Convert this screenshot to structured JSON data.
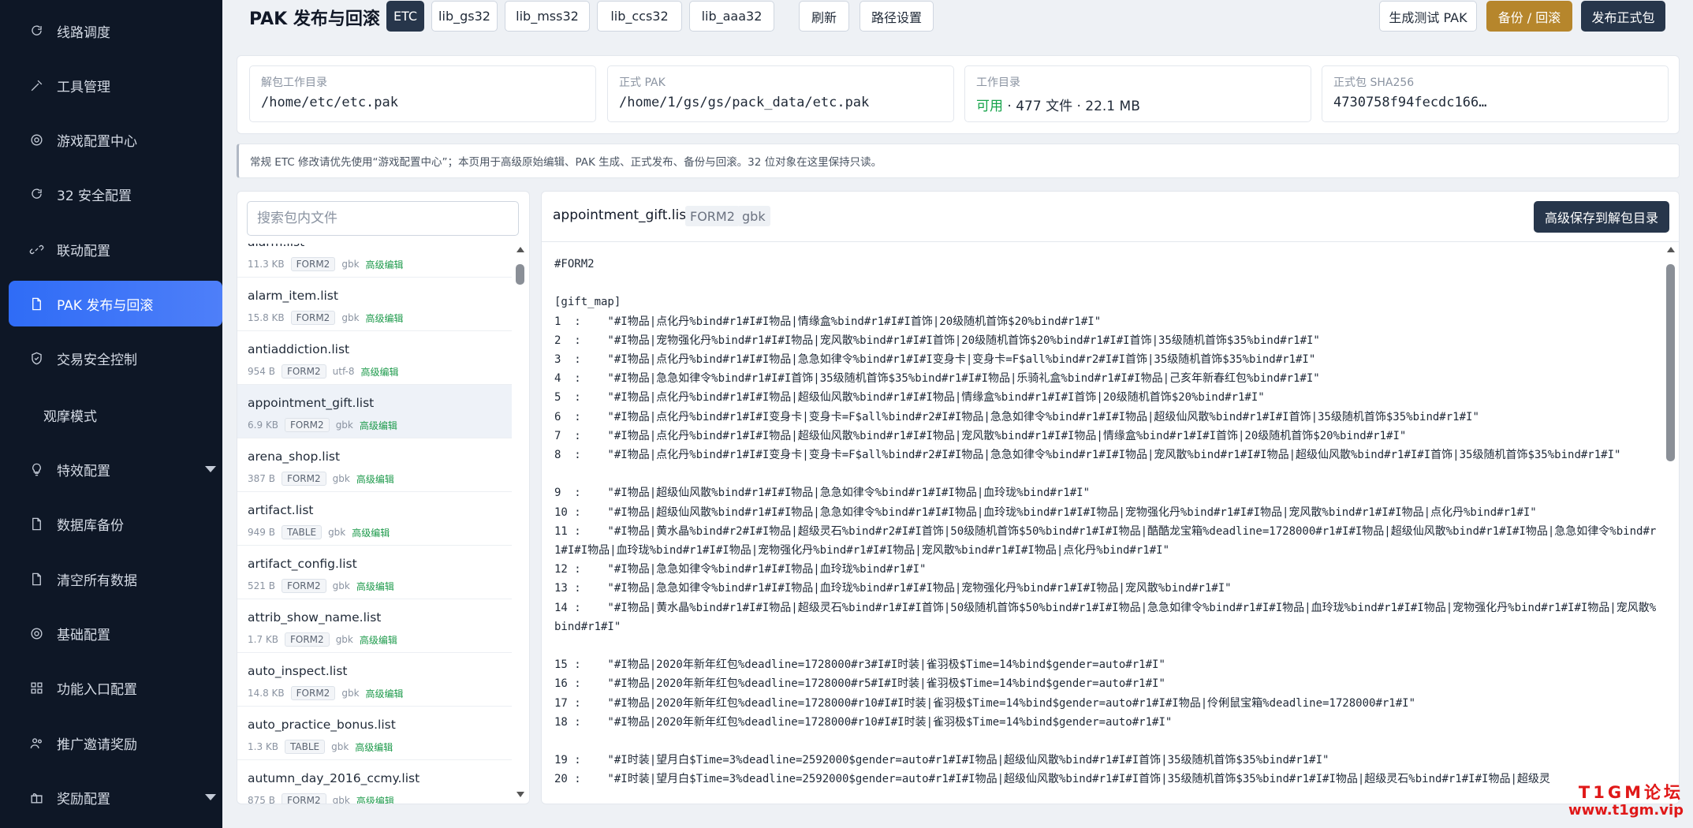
{
  "sidebar": {
    "items": [
      {
        "label": "线路调度",
        "icon": "refresh-icon"
      },
      {
        "label": "工具管理",
        "icon": "tools-icon"
      },
      {
        "label": "游戏配置中心",
        "icon": "gear-icon"
      },
      {
        "label": "32 安全配置",
        "icon": "refresh-icon"
      },
      {
        "label": "联动配置",
        "icon": "link-icon"
      },
      {
        "label": "PAK 发布与回滚",
        "icon": "file-icon"
      },
      {
        "label": "交易安全控制",
        "icon": "shield-icon"
      },
      {
        "label": "观摩模式",
        "icon": ""
      },
      {
        "label": "特效配置",
        "icon": "bulb-icon"
      },
      {
        "label": "数据库备份",
        "icon": "file-icon"
      },
      {
        "label": "清空所有数据",
        "icon": "file-icon"
      },
      {
        "label": "基础配置",
        "icon": "gear-icon"
      },
      {
        "label": "功能入口配置",
        "icon": "grid-icon"
      },
      {
        "label": "推广邀请奖励",
        "icon": "users-icon"
      },
      {
        "label": "奖励配置",
        "icon": "gift-icon"
      }
    ],
    "active_index": 5
  },
  "header": {
    "title": "PAK 发布与回滚",
    "tabs": [
      "ETC",
      "lib_gs32",
      "lib_mss32",
      "lib_ccs32",
      "lib_aaa32"
    ],
    "active_tab": "ETC",
    "refresh": "刷新",
    "path_settings": "路径设置",
    "build_test": "生成测试 PAK",
    "backup_rollback": "备份 / 回滚",
    "publish": "发布正式包"
  },
  "info": {
    "unpack_dir_label": "解包工作目录",
    "unpack_dir": "/home/etc/etc.pak",
    "formal_pak_label": "正式 PAK",
    "formal_pak": "/home/1/gs/gs/pack_data/etc.pak",
    "workdir_label": "工作目录",
    "workdir_status": "可用",
    "workdir_stats": " · 477 文件 · 22.1 MB",
    "sha_label": "正式包 SHA256",
    "sha": "4730758f94fecdc166…"
  },
  "notice": "常规 ETC 修改请优先使用“游戏配置中心”；本页用于高级原始编辑、PAK 生成、正式发布、备份与回滚。32 位对象在这里保持只读。",
  "files": {
    "search_placeholder": "搜索包内文件",
    "edit_label": "高级编辑",
    "items": [
      {
        "name": "alarm.list",
        "size": "11.3 KB",
        "format": "FORM2",
        "enc": "gbk"
      },
      {
        "name": "alarm_item.list",
        "size": "15.8 KB",
        "format": "FORM2",
        "enc": "gbk"
      },
      {
        "name": "antiaddiction.list",
        "size": "954 B",
        "format": "FORM2",
        "enc": "utf-8"
      },
      {
        "name": "appointment_gift.list",
        "size": "6.9 KB",
        "format": "FORM2",
        "enc": "gbk"
      },
      {
        "name": "arena_shop.list",
        "size": "387 B",
        "format": "FORM2",
        "enc": "gbk"
      },
      {
        "name": "artifact.list",
        "size": "949 B",
        "format": "TABLE",
        "enc": "gbk"
      },
      {
        "name": "artifact_config.list",
        "size": "521 B",
        "format": "FORM2",
        "enc": "gbk"
      },
      {
        "name": "attrib_show_name.list",
        "size": "1.7 KB",
        "format": "FORM2",
        "enc": "gbk"
      },
      {
        "name": "auto_inspect.list",
        "size": "14.8 KB",
        "format": "FORM2",
        "enc": "gbk"
      },
      {
        "name": "auto_practice_bonus.list",
        "size": "1.3 KB",
        "format": "TABLE",
        "enc": "gbk"
      },
      {
        "name": "autumn_day_2016_ccmy.list",
        "size": "875 B",
        "format": "FORM2",
        "enc": "gbk"
      }
    ],
    "selected_index": 3
  },
  "editor": {
    "filename": "appointment_gift.list",
    "format": "FORM2",
    "encoding": "gbk",
    "save_label": "高级保存到解包目录",
    "lines": [
      "#FORM2",
      "",
      "[gift_map]",
      "1  :    \"#I物品|点化丹%bind#r1#I#I物品|情缘盒%bind#r1#I#I首饰|20级随机首饰$20%bind#r1#I\"",
      "2  :    \"#I物品|宠物强化丹%bind#r1#I#I物品|宠风散%bind#r1#I#I首饰|20级随机首饰$20%bind#r1#I#I首饰|35级随机首饰$35%bind#r1#I\"",
      "3  :    \"#I物品|点化丹%bind#r1#I#I物品|急急如律令%bind#r1#I#I变身卡|变身卡=F$all%bind#r2#I#I首饰|35级随机首饰$35%bind#r1#I\"",
      "4  :    \"#I物品|急急如律令%bind#r1#I#I首饰|35级随机首饰$35%bind#r1#I#I物品|乐骑礼盒%bind#r1#I#I物品|己亥年新春红包%bind#r1#I\"",
      "5  :    \"#I物品|点化丹%bind#r1#I#I物品|超级仙风散%bind#r1#I#I物品|情缘盒%bind#r1#I#I首饰|20级随机首饰$20%bind#r1#I\"",
      "6  :    \"#I物品|点化丹%bind#r1#I#I变身卡|变身卡=F$all%bind#r2#I#I物品|急急如律令%bind#r1#I#I物品|超级仙风散%bind#r1#I#I首饰|35级随机首饰$35%bind#r1#I\"",
      "7  :    \"#I物品|点化丹%bind#r1#I#I物品|超级仙风散%bind#r1#I#I物品|宠风散%bind#r1#I#I物品|情缘盒%bind#r1#I#I首饰|20级随机首饰$20%bind#r1#I\"",
      "8  :    \"#I物品|点化丹%bind#r1#I#I变身卡|变身卡=F$all%bind#r2#I#I物品|急急如律令%bind#r1#I#I物品|宠风散%bind#r1#I#I物品|超级仙风散%bind#r1#I#I首饰|35级随机首饰$35%bind#r1#I\"",
      "",
      "9  :    \"#I物品|超级仙风散%bind#r1#I#I物品|急急如律令%bind#r1#I#I物品|血玲珑%bind#r1#I\"",
      "10 :    \"#I物品|超级仙风散%bind#r1#I#I物品|急急如律令%bind#r1#I#I物品|血玲珑%bind#r1#I#I物品|宠物强化丹%bind#r1#I#I物品|宠风散%bind#r1#I#I物品|点化丹%bind#r1#I\"",
      "11 :    \"#I物品|黄水晶%bind#r2#I#I物品|超级灵石%bind#r2#I#I首饰|50级随机首饰$50%bind#r1#I#I物品|酷酷龙宝箱%deadline=1728000#r1#I#I物品|超级仙风散%bind#r1#I#I物品|急急如律令%bind#r1#I#I物品|血玲珑%bind#r1#I#I物品|宠物强化丹%bind#r1#I#I物品|宠风散%bind#r1#I#I物品|点化丹%bind#r1#I\"",
      "12 :    \"#I物品|急急如律令%bind#r1#I#I物品|血玲珑%bind#r1#I\"",
      "13 :    \"#I物品|急急如律令%bind#r1#I#I物品|血玲珑%bind#r1#I#I物品|宠物强化丹%bind#r1#I#I物品|宠风散%bind#r1#I\"",
      "14 :    \"#I物品|黄水晶%bind#r1#I#I物品|超级灵石%bind#r1#I#I首饰|50级随机首饰$50%bind#r1#I#I物品|急急如律令%bind#r1#I#I物品|血玲珑%bind#r1#I#I物品|宠物强化丹%bind#r1#I#I物品|宠风散%bind#r1#I\"",
      "",
      "15 :    \"#I物品|2020年新年红包%deadline=1728000#r3#I#I时装|雀羽极$Time=14%bind$gender=auto#r1#I\"",
      "16 :    \"#I物品|2020年新年红包%deadline=1728000#r5#I#I时装|雀羽极$Time=14%bind$gender=auto#r1#I\"",
      "17 :    \"#I物品|2020年新年红包%deadline=1728000#r10#I#I时装|雀羽极$Time=14%bind$gender=auto#r1#I#I物品|伶俐鼠宝箱%deadline=1728000#r1#I\"",
      "18 :    \"#I物品|2020年新年红包%deadline=1728000#r10#I#I时装|雀羽极$Time=14%bind$gender=auto#r1#I\"",
      "",
      "19 :    \"#I时装|望月白$Time=3%deadline=2592000$gender=auto#r1#I#I物品|超级仙风散%bind#r1#I#I首饰|35级随机首饰$35%bind#r1#I\"",
      "20 :    \"#I时装|望月白$Time=3%deadline=2592000$gender=auto#r1#I#I物品|超级仙风散%bind#r1#I#I首饰|35级随机首饰$35%bind#r1#I#I物品|超级灵石%bind#r1#I#I物品|超级灵"
    ]
  },
  "watermark": {
    "line1": "T1GM论坛",
    "line2": "www.t1gm.vip"
  },
  "colors": {
    "sidebar_bg": "#0e1726",
    "active": "#2f6cf6",
    "gold": "#b6862c",
    "dark_button": "#27364b",
    "ok_green": "#15a34a",
    "edit_green": "#1d9a4b"
  }
}
